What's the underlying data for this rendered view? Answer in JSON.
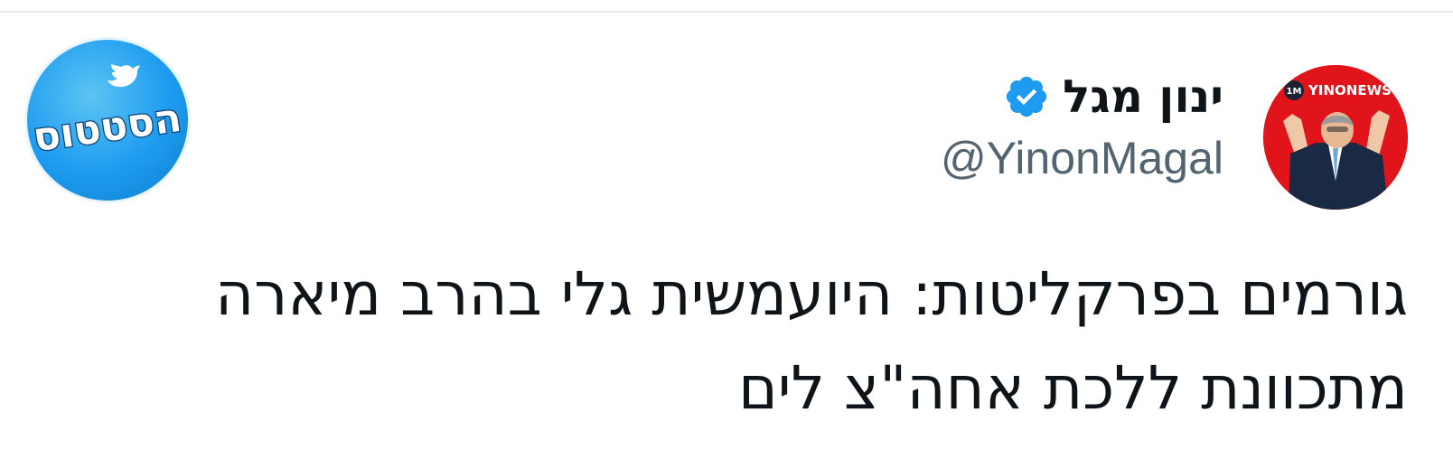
{
  "author": {
    "display_name": "ינון מגל",
    "handle": "@YinonMagal",
    "verified": true,
    "avatar_badge": "YINONEWS",
    "avatar_small_badge": "1M",
    "avatar_bg_color": "#e2141b"
  },
  "brand_logo": {
    "text": "הסטטוס",
    "bg_color": "#1d9bf0",
    "icon": "bird-icon"
  },
  "tweet": {
    "lines": [
      "גורמים בפרקליטות: היועמשית גלי בהרב מיארה",
      "מתכוונת ללכת אחה\"צ לים"
    ]
  },
  "colors": {
    "text_primary": "#0f1419",
    "text_secondary": "#536471",
    "verified_blue": "#1d9bf0"
  }
}
